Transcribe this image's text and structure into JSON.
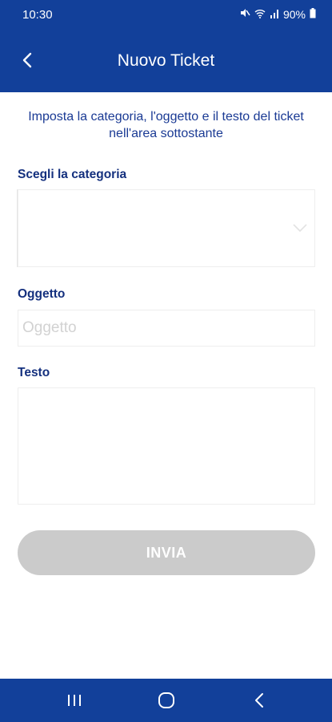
{
  "status_bar": {
    "time": "10:30",
    "battery": "90%"
  },
  "app_bar": {
    "title": "Nuovo Ticket"
  },
  "intro_text": "Imposta la categoria, l'oggetto e il testo del ticket nell'area sottostante",
  "form": {
    "category_label": "Scegli la categoria",
    "category_value": "",
    "subject_label": "Oggetto",
    "subject_placeholder": "Oggetto",
    "subject_value": "",
    "text_label": "Testo",
    "text_value": "",
    "submit_label": "INVIA",
    "submit_enabled": false
  },
  "colors": {
    "primary": "#12409a",
    "label_text": "#14307e",
    "button_disabled": "#cbcbcb"
  },
  "icons": [
    "back-arrow-icon",
    "chevron-down-icon",
    "mute-icon",
    "wifi-icon",
    "signal-icon",
    "battery-icon",
    "recent-apps-icon",
    "home-icon",
    "back-nav-icon"
  ]
}
